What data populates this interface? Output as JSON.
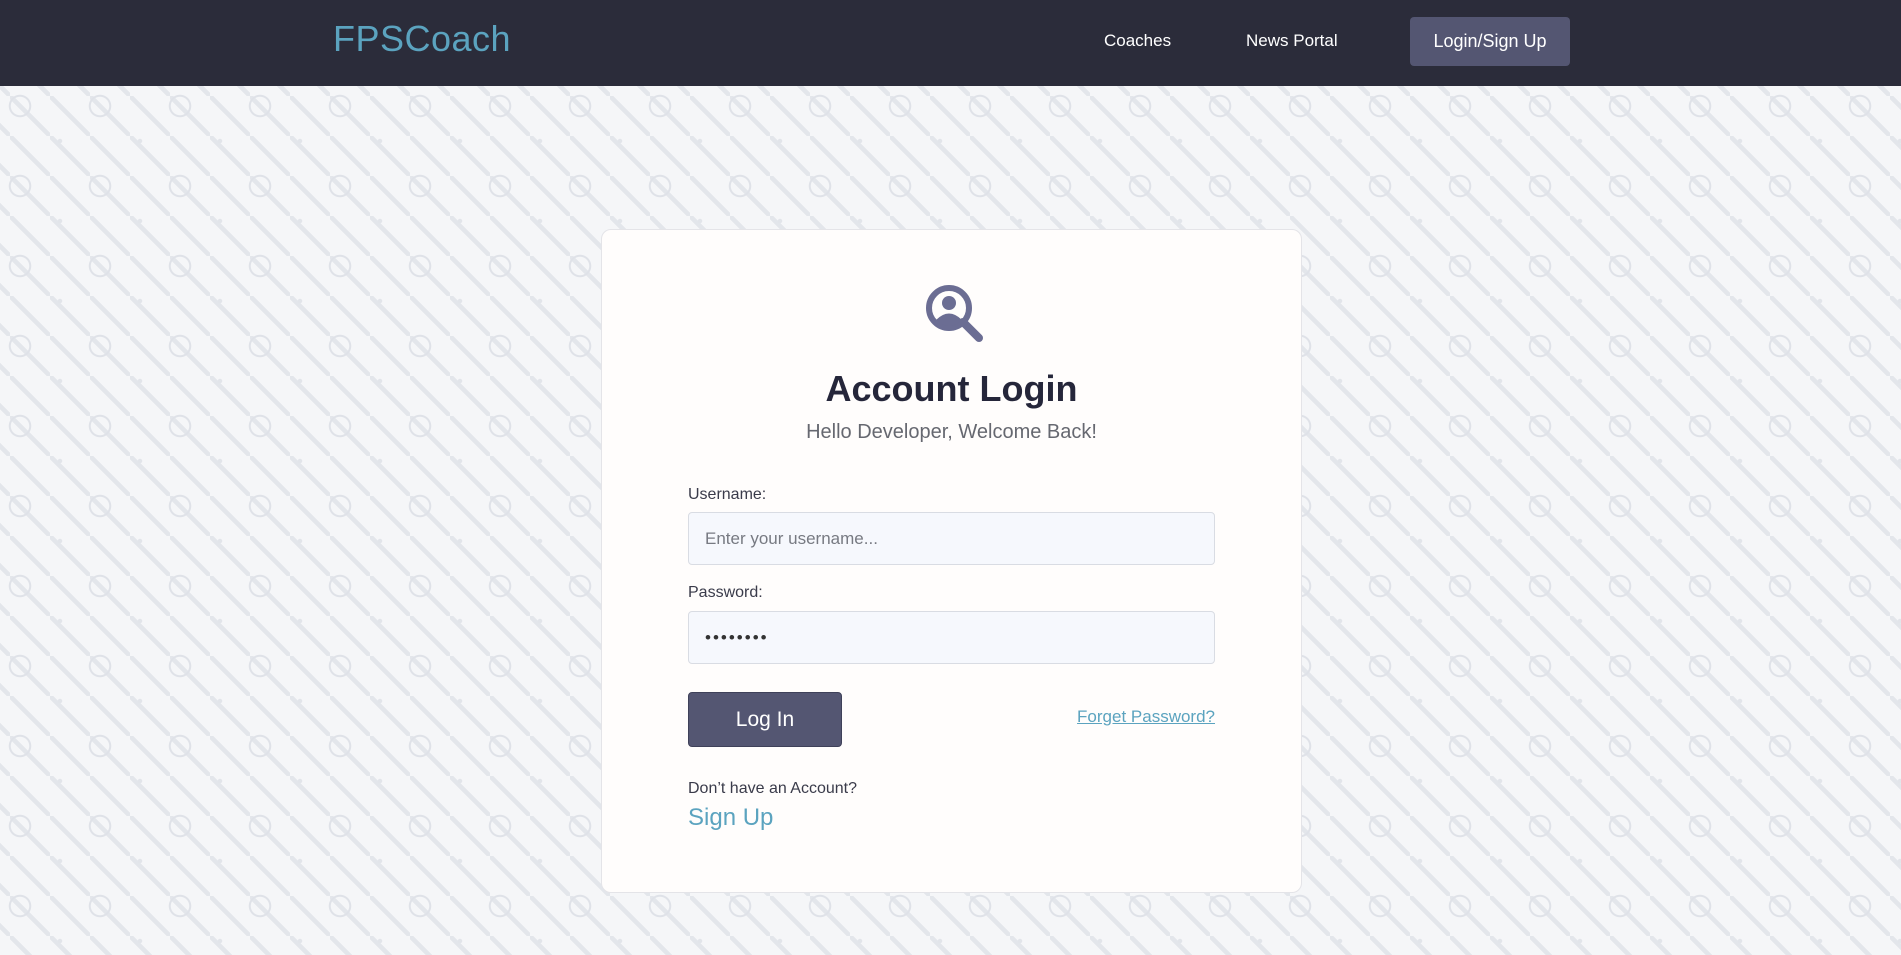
{
  "navbar": {
    "brand": "FPSCoach",
    "links": {
      "coaches": "Coaches",
      "news": "News Portal",
      "login_signup": "Login/Sign Up"
    }
  },
  "login_card": {
    "icon": "user-search-icon",
    "title": "Account Login",
    "subtitle": "Hello Developer, Welcome Back!",
    "username": {
      "label": "Username:",
      "placeholder": "Enter your username...",
      "value": ""
    },
    "password": {
      "label": "Password:",
      "value": "••••••••"
    },
    "login_button": "Log In",
    "forgot_link": "Forget Password?",
    "no_account_text": "Don’t have an Account?",
    "signup_link": "Sign Up"
  },
  "colors": {
    "navbar_bg": "#2b2c3a",
    "brand_accent": "#5ba3bf",
    "button_bg": "#545672",
    "icon": "#6b6d93"
  }
}
